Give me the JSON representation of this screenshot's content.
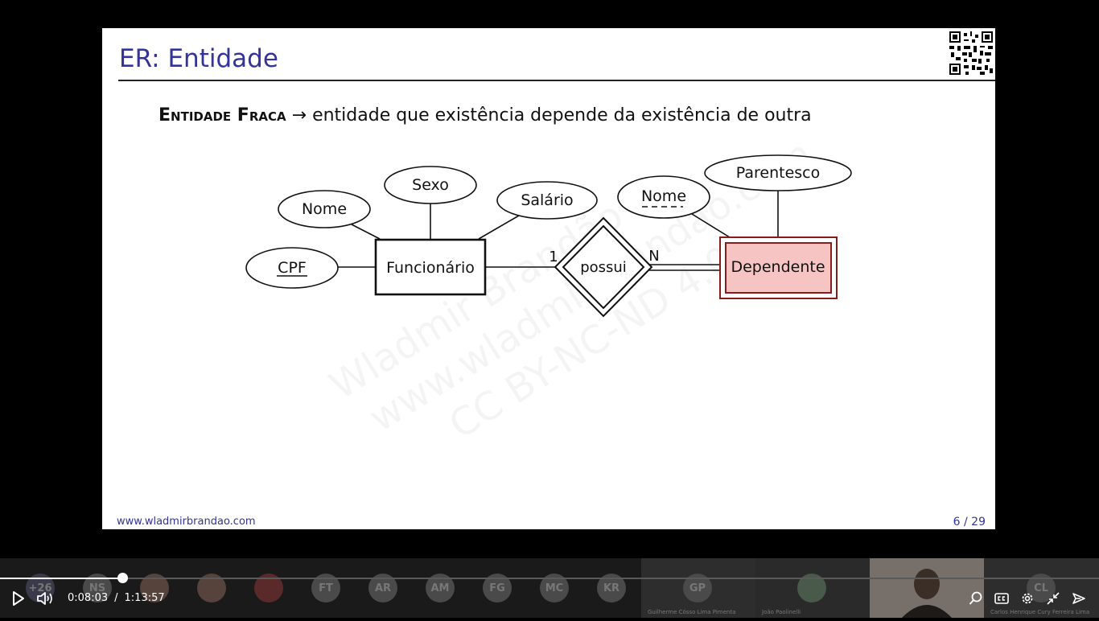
{
  "slide": {
    "title": "ER: Entidade",
    "definition": {
      "term": "Entidade Fraca",
      "arrow": "→",
      "text": "entidade que existência depende da existência de outra"
    },
    "footer_url": "www.wladmirbrandao.com",
    "page": "6 / 29",
    "watermark": [
      "Wladmir Brandão",
      "www.wladmirbrandao.com",
      "CC BY-NC-ND 4.0"
    ]
  },
  "diagram": {
    "entity_strong": "Funcionário",
    "entity_weak": "Dependente",
    "relationship": "possui",
    "card_left": "1",
    "card_right": "N",
    "attrs": {
      "cpf": "CPF",
      "nome_func": "Nome",
      "sexo": "Sexo",
      "salario": "Salário",
      "nome_dep": "Nome",
      "parentesco": "Parentesco"
    },
    "weak_fill": "#f7c4c4",
    "weak_border": "#8b1a1a"
  },
  "player": {
    "current_time": "0:08:03",
    "separator": "/",
    "duration": "1:13:57",
    "progress": 0.112,
    "participants": [
      "+26",
      "NS",
      "",
      "",
      "",
      "FT",
      "AR",
      "AM",
      "FG",
      "MC",
      "KR"
    ],
    "tiles": [
      {
        "initials": "GP",
        "name": "Guilherme Cósso Lima Pimenta"
      },
      {
        "initials": "",
        "name": "João Paolinelli"
      },
      {
        "initials": "",
        "name": ""
      },
      {
        "initials": "CL",
        "name": "Carlos Henrique Cury Ferreira Lima"
      }
    ]
  }
}
